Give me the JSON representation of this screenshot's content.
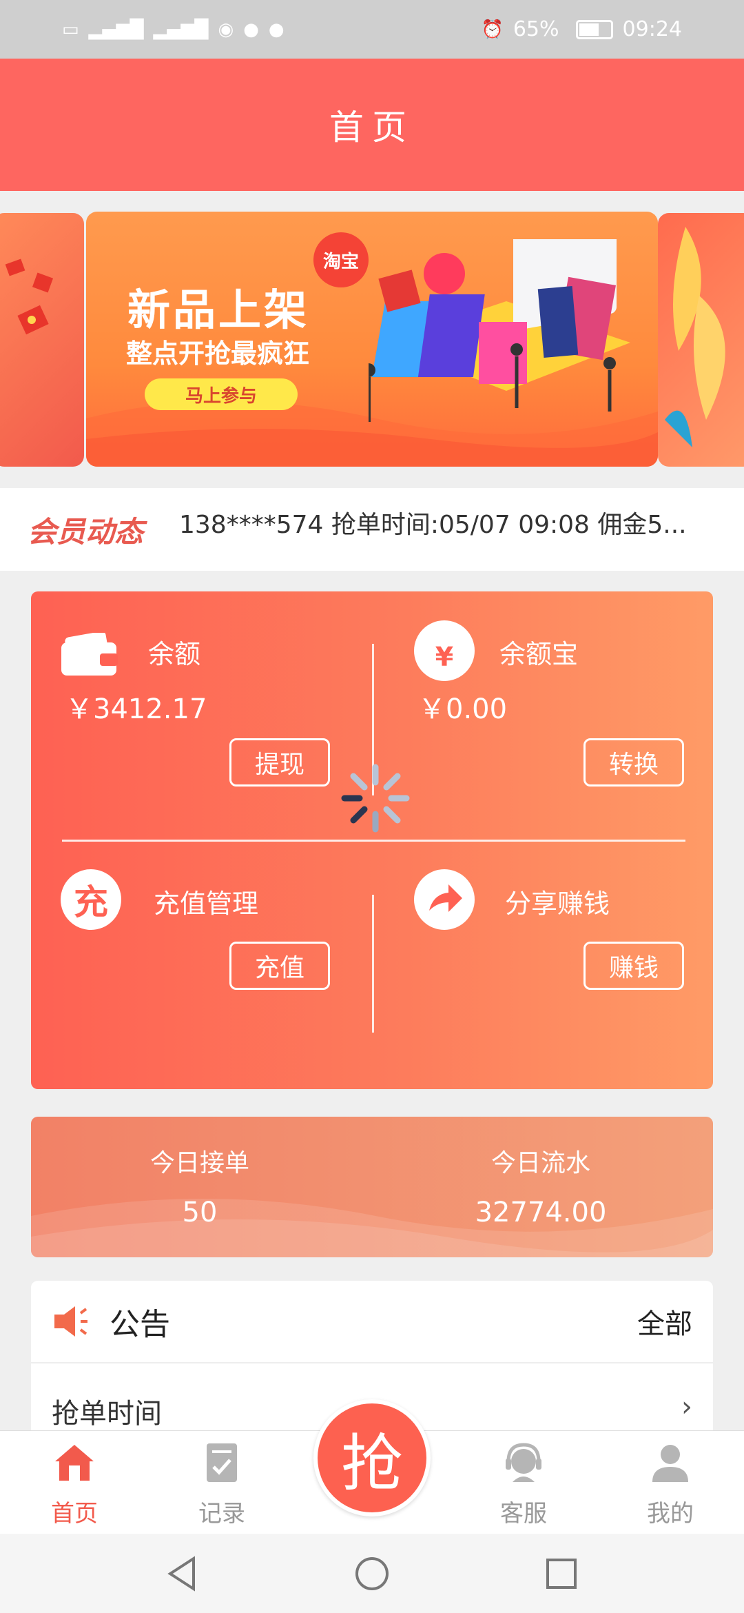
{
  "status_bar": {
    "time": "09:24",
    "battery": "65%",
    "left_icons": [
      "hd-icon",
      "signal-4g-icon",
      "signal-4g-icon",
      "eye-icon",
      "wechat-icon",
      "message-icon"
    ]
  },
  "header": {
    "title": "首页"
  },
  "banner": {
    "title": "新品上架",
    "subtitle": "整点开抢最疯狂",
    "button": "马上参与",
    "tag": "淘宝"
  },
  "ticker": {
    "label": "会员动态",
    "text": "138****574 抢单时间:05/07 09:08 佣金5..."
  },
  "wallet": {
    "balance": {
      "label": "余额",
      "amount": "￥3412.17",
      "button": "提现"
    },
    "yuebao": {
      "label": "余额宝",
      "amount": "￥0.00",
      "button": "转换"
    },
    "recharge": {
      "label": "充值管理",
      "icon_char": "充",
      "button": "充值"
    },
    "share": {
      "label": "分享赚钱",
      "button": "赚钱"
    }
  },
  "stats": {
    "orders": {
      "label": "今日接单",
      "value": "50"
    },
    "flow": {
      "label": "今日流水",
      "value": "32774.00"
    }
  },
  "notice": {
    "title": "公告",
    "all": "全部",
    "item": "抢单时间"
  },
  "tabbar": {
    "home": "首页",
    "records": "记录",
    "grab": "抢",
    "service": "客服",
    "mine": "我的"
  },
  "colors": {
    "accent": "#fe6660",
    "card_start": "#fe6153",
    "card_end": "#ff9b66",
    "inactive": "#999999"
  }
}
